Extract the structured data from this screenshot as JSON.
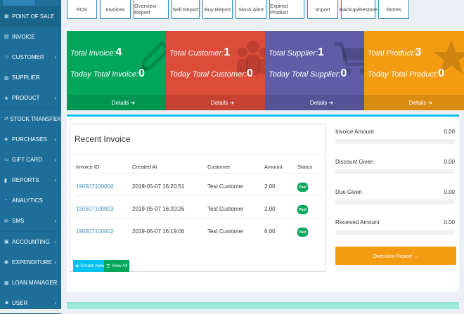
{
  "sidebar": {
    "items": [
      {
        "label": "POINT OF SALE",
        "icon": "grid-icon",
        "chevron": false
      },
      {
        "label": "INVOICE",
        "icon": "file-icon",
        "chevron": false
      },
      {
        "label": "CUSTOMER",
        "icon": "user-icon",
        "chevron": true
      },
      {
        "label": "SUPPLIER",
        "icon": "building-icon",
        "chevron": false
      },
      {
        "label": "PRODUCT",
        "icon": "star-icon",
        "chevron": true
      },
      {
        "label": "STOCK TRANSFER",
        "icon": "transfer-icon",
        "chevron": true
      },
      {
        "label": "PURCHASES",
        "icon": "cart-icon",
        "chevron": true
      },
      {
        "label": "GIFT CARD",
        "icon": "card-icon",
        "chevron": true
      },
      {
        "label": "REPORTS",
        "icon": "chart-icon",
        "chevron": true
      },
      {
        "label": "ANALYTICS",
        "icon": "analytics-icon",
        "chevron": false
      },
      {
        "label": "SMS",
        "icon": "envelope-icon",
        "chevron": true
      },
      {
        "label": "ACCOUNTING",
        "icon": "ledger-icon",
        "chevron": true
      },
      {
        "label": "EXPENDITURE",
        "icon": "money-icon",
        "chevron": true
      },
      {
        "label": "LOAN MANAGER",
        "icon": "briefcase-icon",
        "chevron": true
      },
      {
        "label": "USER",
        "icon": "users-icon",
        "chevron": true
      }
    ]
  },
  "topnav": [
    "POS",
    "Invoices",
    "Overview Report",
    "Sell Report",
    "Buy Report",
    "Stock Alert",
    "Expired Product",
    "Import",
    "Backup/Restore",
    "Stores"
  ],
  "cards": [
    {
      "label1": "Total Invoice:",
      "value1": "4",
      "label2": "Today Total Invoice:",
      "value2": "0",
      "footer": "Details",
      "color": "#00a65a",
      "icon": "pencil-icon"
    },
    {
      "label1": "Total Customer:",
      "value1": "1",
      "label2": "Today Total Customer:",
      "value2": "0",
      "footer": "Details",
      "color": "#dd4b39",
      "icon": "users-group-icon"
    },
    {
      "label1": "Total Supplier:",
      "value1": "1",
      "label2": "Today Total Supplier:",
      "value2": "0",
      "footer": "Details",
      "color": "#605ca8",
      "icon": "cart-icon"
    },
    {
      "label1": "Total Product:",
      "value1": "3",
      "label2": "Today Total Product:",
      "value2": "0",
      "footer": "Details",
      "color": "#f39c12",
      "icon": "star-icon"
    }
  ],
  "recent": {
    "title": "Recent Invoice",
    "headers": [
      "Invoice ID",
      "Created At",
      "Customer",
      "Amount",
      "Status"
    ],
    "rows": [
      {
        "id": "190507100004",
        "created": "2019-05-07 16:20:51",
        "customer": "Test Customer",
        "amount": "2.00",
        "status": "Paid"
      },
      {
        "id": "190507100003",
        "created": "2019-05-07 16:20:26",
        "customer": "Test Customer",
        "amount": "2.00",
        "status": "Paid"
      },
      {
        "id": "190507100002",
        "created": "2019-05-07 16:19:06",
        "customer": "Test Customer",
        "amount": "6.00",
        "status": "Paid"
      }
    ],
    "create_label": "Create New",
    "view_label": "View All"
  },
  "summary": [
    {
      "label": "Invoice Amount",
      "value": "0.00"
    },
    {
      "label": "Discount Given",
      "value": "0.00"
    },
    {
      "label": "Due Given",
      "value": "0.00"
    },
    {
      "label": "Received Amount",
      "value": "0.00"
    }
  ],
  "overview_button": "Overview Report →"
}
